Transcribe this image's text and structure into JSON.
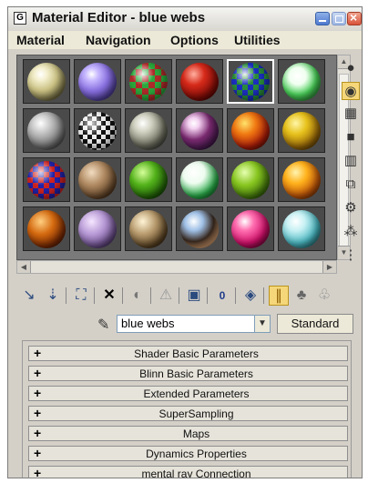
{
  "window": {
    "title": "Material Editor - blue webs",
    "icon": "material-editor-icon"
  },
  "title_buttons": [
    "minimize",
    "maximize",
    "close"
  ],
  "menu": [
    "Material",
    "Navigation",
    "Options",
    "Utilities"
  ],
  "sample_slots": [
    {
      "material": "cream-glossy"
    },
    {
      "material": "lavender-glossy"
    },
    {
      "material": "green-checker-glossy"
    },
    {
      "material": "red-cellular"
    },
    {
      "material": "blue-checker-webs",
      "active": true
    },
    {
      "material": "white-green-spots"
    },
    {
      "material": "grey-speckled"
    },
    {
      "material": "black-white-checker"
    },
    {
      "material": "grey-cracked-stone"
    },
    {
      "material": "purple-abstract"
    },
    {
      "material": "fire-cellular"
    },
    {
      "material": "yellow-marble"
    },
    {
      "material": "rgb-checker"
    },
    {
      "material": "wood-grain"
    },
    {
      "material": "green-cellular"
    },
    {
      "material": "white-green-splatter"
    },
    {
      "material": "green-stripes"
    },
    {
      "material": "orange-bubbles"
    },
    {
      "material": "orange-swirl"
    },
    {
      "material": "purple-bumpy"
    },
    {
      "material": "bronze-metal"
    },
    {
      "material": "black-chrome"
    },
    {
      "material": "magenta-glossy"
    },
    {
      "material": "teal-splash"
    }
  ],
  "side_toolbar": [
    "sample-type-sphere-icon",
    "backlight-icon",
    "checker-background-icon",
    "sample-uv-tiling-icon",
    "video-color-check-icon",
    "make-preview-icon",
    "options-icon",
    "select-by-material-icon",
    "material-map-navigator-icon"
  ],
  "bottom_toolbar": [
    "get-material-icon",
    "put-to-scene-icon",
    "assign-to-selection-icon",
    "reset-map-icon",
    "make-copy-icon",
    "make-unique-icon",
    "put-to-library-icon",
    "material-effects-channel-icon",
    "show-map-in-viewport-icon",
    "show-end-result-icon",
    "go-to-parent-icon",
    "go-forward-to-sibling-icon"
  ],
  "material_name": "blue webs",
  "material_type": "Standard",
  "rollouts": [
    "Shader Basic Parameters",
    "Blinn Basic Parameters",
    "Extended Parameters",
    "SuperSampling",
    "Maps",
    "Dynamics Properties",
    "mental ray Connection"
  ],
  "rollout_symbol": "+"
}
